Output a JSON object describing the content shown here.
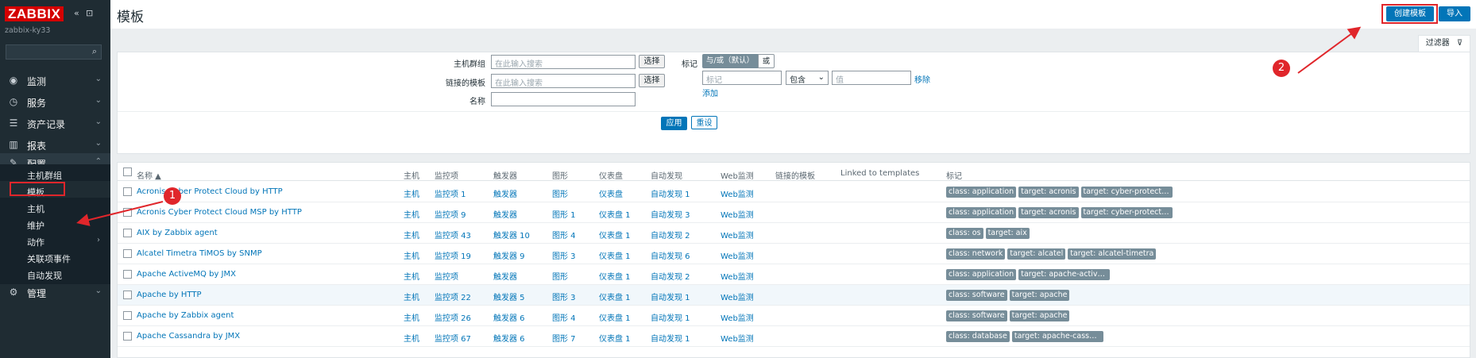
{
  "sidebar": {
    "logo": "ZABBIX",
    "collapse_icon": "«",
    "popout_icon": "⊡",
    "server_name": "zabbix-ky33",
    "search_placeholder": "",
    "search_icon": "⌕",
    "menu": [
      {
        "label": "监测",
        "icon": "eye-icon",
        "glyph": "◉"
      },
      {
        "label": "服务",
        "icon": "clock-icon",
        "glyph": "◷"
      },
      {
        "label": "资产记录",
        "icon": "list-icon",
        "glyph": "☰"
      },
      {
        "label": "报表",
        "icon": "chart-icon",
        "glyph": "▥"
      },
      {
        "label": "配置",
        "icon": "wrench-icon",
        "glyph": "✎"
      }
    ],
    "config_sub": [
      {
        "label": "主机群组"
      },
      {
        "label": "模板"
      },
      {
        "label": "主机"
      },
      {
        "label": "维护"
      },
      {
        "label": "动作"
      },
      {
        "label": "关联项事件"
      },
      {
        "label": "自动发现"
      }
    ],
    "admin": {
      "label": "管理",
      "icon": "gear-icon",
      "glyph": "⚙"
    }
  },
  "header": {
    "title": "模板",
    "create_button": "创建模板",
    "import_button": "导入"
  },
  "filter": {
    "tab_label": "过滤器",
    "host_group_label": "主机群组",
    "host_group_placeholder": "在此输入搜索",
    "linked_template_label": "链接的模板",
    "linked_template_placeholder": "在此输入搜索",
    "name_label": "名称",
    "name_value": "",
    "select_button": "选择",
    "tags_label": "标记",
    "and_or_label": "与/或（默认）",
    "or_label": "或",
    "tag_placeholder": "标记",
    "operator_value": "包含",
    "value_placeholder": "值",
    "remove_link": "移除",
    "add_link": "添加",
    "apply_button": "应用",
    "reset_button": "重设"
  },
  "table": {
    "headers": {
      "name": "名称 ▲",
      "hosts": "主机",
      "items": "监控项",
      "triggers": "触发器",
      "graphs": "图形",
      "dashboards": "仪表盘",
      "discovery": "自动发现",
      "web": "Web监测",
      "linked_templates": "链接的模板",
      "linked_to": "Linked to templates",
      "tags": "标记"
    },
    "rows": [
      {
        "name": "Acronis Cyber Protect Cloud by HTTP",
        "hosts": "主机",
        "items": "监控项 1",
        "triggers": "触发器",
        "graphs": "图形",
        "dashboards": "仪表盘",
        "discovery": "自动发现 1",
        "web": "Web监测",
        "tags": [
          "class: application",
          "target: acronis",
          "target: cyber-protect-cl..."
        ]
      },
      {
        "name": "Acronis Cyber Protect Cloud MSP by HTTP",
        "hosts": "主机",
        "items": "监控项 9",
        "triggers": "触发器",
        "graphs": "图形 1",
        "dashboards": "仪表盘 1",
        "discovery": "自动发现 3",
        "web": "Web监测",
        "tags": [
          "class: application",
          "target: acronis",
          "target: cyber-protect-cl..."
        ]
      },
      {
        "name": "AIX by Zabbix agent",
        "hosts": "主机",
        "items": "监控项 43",
        "triggers": "触发器 10",
        "graphs": "图形 4",
        "dashboards": "仪表盘 1",
        "discovery": "自动发现 2",
        "web": "Web监测",
        "tags": [
          "class: os",
          "target: aix"
        ]
      },
      {
        "name": "Alcatel Timetra TiMOS by SNMP",
        "hosts": "主机",
        "items": "监控项 19",
        "triggers": "触发器 9",
        "graphs": "图形 3",
        "dashboards": "仪表盘 1",
        "discovery": "自动发现 6",
        "web": "Web监测",
        "tags": [
          "class: network",
          "target: alcatel",
          "target: alcatel-timetra"
        ]
      },
      {
        "name": "Apache ActiveMQ by JMX",
        "hosts": "主机",
        "items": "监控项",
        "triggers": "触发器",
        "graphs": "图形",
        "dashboards": "仪表盘 1",
        "discovery": "自动发现 2",
        "web": "Web监测",
        "tags": [
          "class: application",
          "target: apache-activemq"
        ]
      },
      {
        "name": "Apache by HTTP",
        "hosts": "主机",
        "items": "监控项 22",
        "triggers": "触发器 5",
        "graphs": "图形 3",
        "dashboards": "仪表盘 1",
        "discovery": "自动发现 1",
        "web": "Web监测",
        "tags": [
          "class: software",
          "target: apache"
        ]
      },
      {
        "name": "Apache by Zabbix agent",
        "hosts": "主机",
        "items": "监控项 26",
        "triggers": "触发器 6",
        "graphs": "图形 4",
        "dashboards": "仪表盘 1",
        "discovery": "自动发现 1",
        "web": "Web监测",
        "tags": [
          "class: software",
          "target: apache"
        ]
      },
      {
        "name": "Apache Cassandra by JMX",
        "hosts": "主机",
        "items": "监控项 67",
        "triggers": "触发器 6",
        "graphs": "图形 7",
        "dashboards": "仪表盘 1",
        "discovery": "自动发现 1",
        "web": "Web监测",
        "tags": [
          "class: database",
          "target: apache-cassan..."
        ]
      }
    ]
  },
  "annotations": {
    "marker_1": "1",
    "marker_2": "2"
  },
  "colors": {
    "accent": "#0275b8",
    "sidebar_bg": "#1f2c33",
    "logo_red": "#d40000",
    "annotation_red": "#e0262b",
    "tag_gray": "#768d99"
  }
}
